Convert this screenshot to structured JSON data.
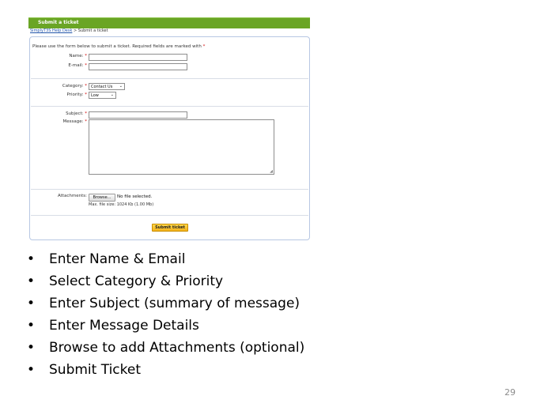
{
  "screenshot": {
    "title": "Submit a ticket",
    "breadcrumb": {
      "home_link": "SimplyT3S Help Desk",
      "separator": ">",
      "current": "Submit a ticket"
    },
    "intro_text": "Please use the form below to submit a ticket. Required fields are marked with",
    "required_marker": "*",
    "fields": {
      "name_label": "Name:",
      "email_label": "E-mail:",
      "category_label": "Category:",
      "category_value": "Contact Us",
      "priority_label": "Priority:",
      "priority_value": "Low",
      "subject_label": "Subject:",
      "message_label": "Message:",
      "attachments_label": "Attachments:",
      "browse_label": "Browse...",
      "no_file_text": "No file selected.",
      "max_size_text": "Max. file size: 1024 Kb (1.00 Mb)"
    },
    "submit_label": "Submit ticket"
  },
  "bullets": [
    "Enter Name & Email",
    "Select Category & Priority",
    "Enter Subject (summary of message)",
    "Enter Message Details",
    "Browse to add Attachments (optional)",
    "Submit Ticket"
  ],
  "bullet_char": "•",
  "page_number": "29",
  "colors": {
    "title_bar": "#6aa525",
    "submit_button": "#f3b21b",
    "required": "#d10000",
    "form_border": "#b7c7e3"
  }
}
